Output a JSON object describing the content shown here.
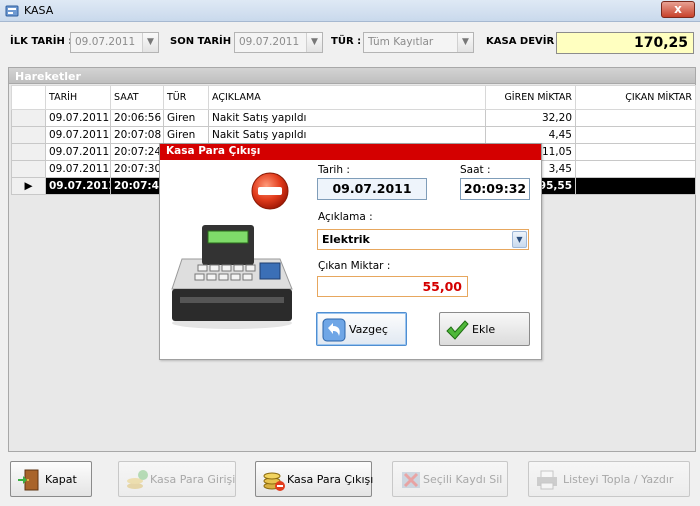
{
  "window": {
    "title": "KASA",
    "close_label": "x"
  },
  "filters": {
    "ilk_tarih_label": "İLK TARİH :",
    "ilk_tarih_value": "09.07.2011",
    "son_tarih_label": "SON TARİH :",
    "son_tarih_value": "09.07.2011",
    "tur_label": "TÜR :",
    "tur_value": "Tüm Kayıtlar",
    "kasa_devir_label": "KASA DEVİR :",
    "kasa_devir_value": "170,25"
  },
  "panel": {
    "title": "Hareketler"
  },
  "table": {
    "columns": [
      "TARİH",
      "SAAT",
      "TÜR",
      "AÇIKLAMA",
      "GİREN MİKTAR",
      "ÇIKAN MİKTAR"
    ],
    "rows": [
      {
        "tarih": "09.07.2011",
        "saat": "20:06:56",
        "tur": "Giren",
        "aciklama": "Nakit Satış yapıldı",
        "giren": "32,20",
        "cikan": ""
      },
      {
        "tarih": "09.07.2011",
        "saat": "20:07:08",
        "tur": "Giren",
        "aciklama": "Nakit Satış yapıldı",
        "giren": "4,45",
        "cikan": ""
      },
      {
        "tarih": "09.07.2011",
        "saat": "20:07:24",
        "tur": "",
        "aciklama": "",
        "giren": "11,05",
        "cikan": ""
      },
      {
        "tarih": "09.07.2011",
        "saat": "20:07:30",
        "tur": "",
        "aciklama": "",
        "giren": "3,45",
        "cikan": ""
      },
      {
        "tarih": "09.07.2011",
        "saat": "20:07:48",
        "tur": "",
        "aciklama": "",
        "giren": "95,55",
        "cikan": ""
      }
    ],
    "active_row_marker": "▶"
  },
  "dialog": {
    "title": "Kasa Para Çıkışı",
    "tarih_label": "Tarih :",
    "tarih_value": "09.07.2011",
    "saat_label": "Saat :",
    "saat_value": "20:09:32",
    "aciklama_label": "Açıklama :",
    "aciklama_value": "Elektrik",
    "cikan_label": "Çıkan Miktar :",
    "cikan_value": "55,00",
    "cancel_label": "Vazgeç",
    "add_label": "Ekle"
  },
  "toolbar": {
    "kapat": "Kapat",
    "giris": "Kasa Para Girişi",
    "cikis": "Kasa Para Çıkışı",
    "sil": "Seçili Kaydı Sil",
    "topla": "Listeyi Topla / Yazdır"
  },
  "colors": {
    "dialog_title_bg": "#d40000",
    "devir_bg": "#ffffc0",
    "amount_text": "#d40000"
  }
}
